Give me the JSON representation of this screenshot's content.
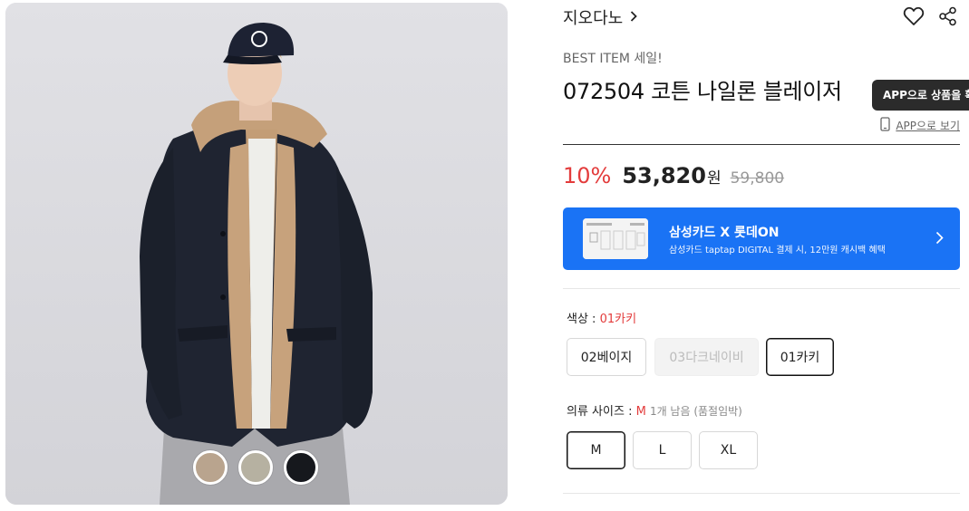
{
  "product": {
    "brand": "지오다노",
    "promo": "BEST ITEM 세일!",
    "title": "072504 코튼 나일론 블레이저",
    "tooltip": "APP으로 상품을 확",
    "app_view_label": "APP으로 보기"
  },
  "price": {
    "discount": "10%",
    "sale": "53,820",
    "currency": "원",
    "original": "59,800"
  },
  "banner": {
    "title": "삼성카드 X 롯데ON",
    "subtitle": "삼성카드 taptap DIGITAL 결제 시, 12만원 캐시백 혜택",
    "color": "#1a73f5"
  },
  "color_option": {
    "label": "색상 : ",
    "selected": "01카키",
    "options": [
      {
        "label": "02베이지",
        "state": "normal"
      },
      {
        "label": "03다크네이비",
        "state": "disabled"
      },
      {
        "label": "01카키",
        "state": "selected"
      }
    ]
  },
  "size_option": {
    "label": "의류 사이즈 : ",
    "selected": "M",
    "stock_note": "1개 남음 (품절임박)",
    "options": [
      {
        "label": "M",
        "state": "selected"
      },
      {
        "label": "L",
        "state": "normal"
      },
      {
        "label": "XL",
        "state": "normal"
      }
    ]
  },
  "swatches": [
    {
      "name": "beige",
      "color": "#b9a48e"
    },
    {
      "name": "khaki-grey",
      "color": "#b6b1a1"
    },
    {
      "name": "dark-navy",
      "color": "#16181d"
    }
  ],
  "icons": {
    "heart": "heart-icon",
    "share": "share-icon",
    "phone": "phone-icon",
    "chevron": "chevron-right-icon"
  },
  "accent_red": "#e33c3c"
}
